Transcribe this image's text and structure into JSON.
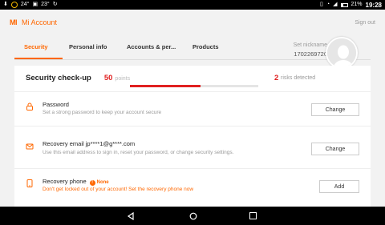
{
  "status_bar": {
    "temperature": "24°",
    "temperature_small": "23°",
    "battery": "21%",
    "time": "19:28"
  },
  "header": {
    "logo": "MI",
    "title": "Mi Account",
    "signout_label": "Sign out"
  },
  "tabs": [
    {
      "label": "Security",
      "active": true
    },
    {
      "label": "Personal info",
      "active": false
    },
    {
      "label": "Accounts & per...",
      "active": false
    },
    {
      "label": "Products",
      "active": false
    }
  ],
  "profile": {
    "nickname_label": "Set nickname",
    "user_id": "1702269720"
  },
  "checkup": {
    "title": "Security check-up",
    "score": "50",
    "points_label": "points",
    "progress_fraction": 0.55,
    "risk_count": "2",
    "risk_label": "risks detected"
  },
  "rows": [
    {
      "icon": "lock-icon",
      "title": "Password",
      "description": "Set a strong password to keep your account secure",
      "button": "Change"
    },
    {
      "icon": "envelope-icon",
      "title": "Recovery email jp****1@g****.com",
      "description": "Use this email address to sign in, reset your password, or change security settings.",
      "button": "Change"
    },
    {
      "icon": "phone-icon",
      "title": "Recovery phone",
      "badge": "None",
      "description": "Don't get locked out of your account! Set the recovery phone now",
      "button": "Add"
    }
  ],
  "colors": {
    "accent": "#ff6700",
    "risk": "#e02020"
  }
}
